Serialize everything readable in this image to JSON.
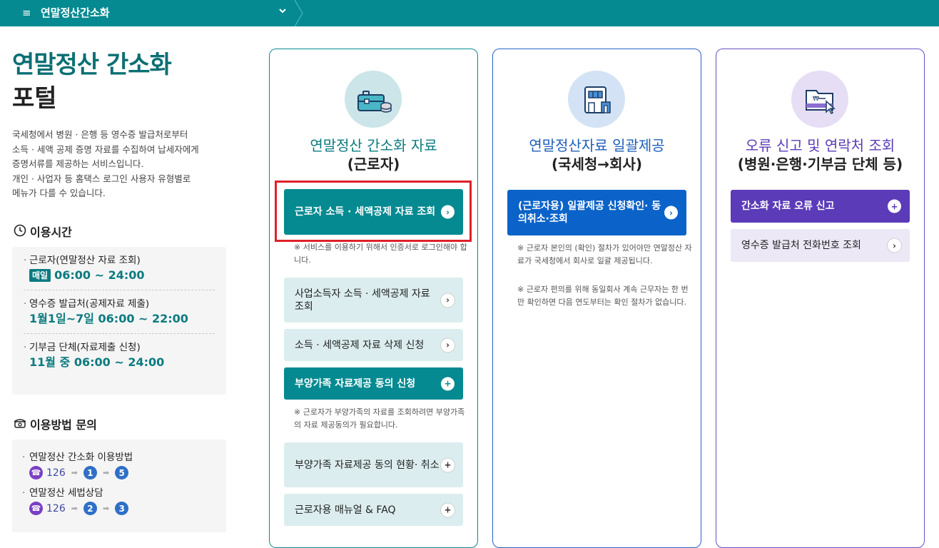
{
  "topbar": {
    "menu_icon": "≡",
    "breadcrumb": "연말정산간소화",
    "chevron": "chevron-down-icon"
  },
  "left": {
    "title_line1": "연말정산 간소화",
    "title_line2": "포털",
    "description": [
      "국세청에서 병원 · 은행 등 영수증 발급처로부터",
      "소득 · 세액 공제 증명 자료를 수집하여 납세자에게",
      "증명서류를 제공하는 서비스입니다.",
      "개인 · 사업자 등 홈택스 로그인 사용자 유형별로",
      "메뉴가 다를 수 있습니다."
    ],
    "hours_title": "이용시간",
    "hours": [
      {
        "label": "근로자(연말정산 자료 조회)",
        "badge": "매일",
        "time": "06:00 ~ 24:00"
      },
      {
        "label": "영수증 발급처(공제자료 제출)",
        "badge": "",
        "time": "1월1일~7일 06:00 ~ 22:00"
      },
      {
        "label": "기부금 단체(자료제출 신청)",
        "badge": "",
        "time": "11월 중 06:00 ~ 24:00"
      }
    ],
    "inquiry_title": "이용방법 문의",
    "inquiry": [
      {
        "label": "연말정산 간소화 이용방법",
        "number": "126",
        "step1": "1",
        "step2": "5"
      },
      {
        "label": "연말정산 세법상담",
        "number": "126",
        "step1": "2",
        "step2": "3"
      }
    ]
  },
  "cards": [
    {
      "title_line1": "연말정산 간소화 자료",
      "title_line2": "(근로자)",
      "items": [
        {
          "label": "근로자 소득 · 세액공제 자료 조회",
          "icon": "chevron-right-icon"
        },
        {
          "note": "※ 서비스를 이용하기 위해서 인증서로 로그인해야 합니다."
        },
        {
          "label": "사업소득자 소득 · 세액공제 자료 조회",
          "icon": "chevron-right-icon"
        },
        {
          "label": "소득 · 세액공제 자료 삭제 신청",
          "icon": "chevron-right-icon"
        },
        {
          "label": "부양가족 자료제공 동의 신청",
          "icon": "plus-icon"
        },
        {
          "note": "※ 근로자가 부양가족의 자료를 조회하려면 부양가족의 자료 제공동의가 필요합니다."
        },
        {
          "label": "부양가족 자료제공 동의 현황· 취소",
          "icon": "plus-icon"
        },
        {
          "label": "근로자용 매뉴얼 & FAQ",
          "icon": "plus-icon"
        }
      ]
    },
    {
      "title_line1": "연말정산자료 일괄제공",
      "title_line2": "(국세청→회사)",
      "items": [
        {
          "label": "(근로자용) 일괄제공 신청확인· 동의취소·조회",
          "icon": "chevron-right-icon"
        },
        {
          "note": "※ 근로자 본인의 (확인) 절차가 있어야만 연말정산 자료가 국세청에서 회사로 일괄 제공됩니다."
        },
        {
          "note": "※ 근로자 편의를 위해 동일회사 계속 근무자는 한 번만 확인하면 다음 연도부터는 확인 절차가 없습니다."
        }
      ]
    },
    {
      "title_line1": "오류 신고 및 연락처 조회",
      "title_line2": "(병원·은행·기부금 단체 등)",
      "items": [
        {
          "label": "간소화 자료 오류 신고",
          "icon": "plus-icon"
        },
        {
          "label": "영수증 발급처 전화번호 조회",
          "icon": "chevron-right-icon"
        }
      ]
    }
  ],
  "colors": {
    "teal": "#058a91",
    "blue": "#0b63c9",
    "purple": "#5b3bb8",
    "highlight": "#e0202a"
  }
}
